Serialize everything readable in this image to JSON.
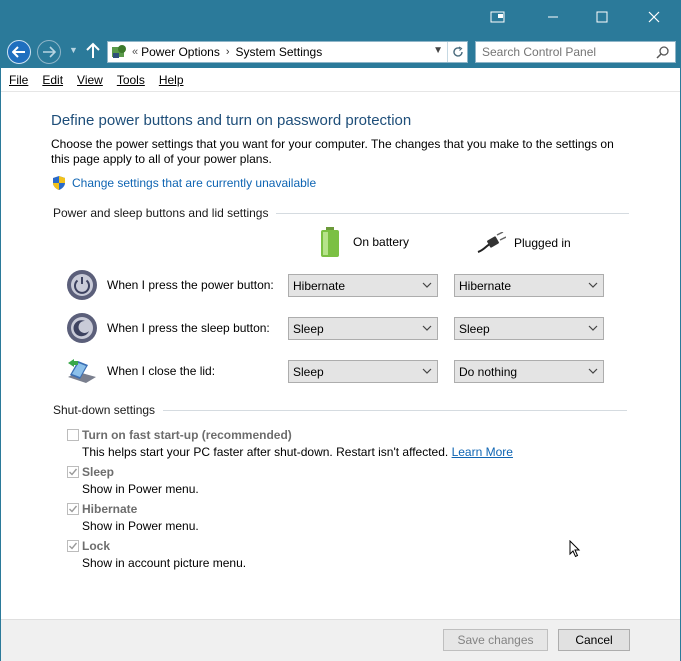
{
  "titlebar": {
    "buttons": [
      "pin",
      "minimize",
      "maximize",
      "close"
    ]
  },
  "address": {
    "overflow": "«",
    "crumbs": [
      "Power Options",
      "System Settings"
    ],
    "search_placeholder": "Search Control Panel"
  },
  "menu": [
    "File",
    "Edit",
    "View",
    "Tools",
    "Help"
  ],
  "page": {
    "title": "Define power buttons and turn on password protection",
    "description": "Choose the power settings that you want for your computer. The changes that you make to the settings on this page apply to all of your power plans.",
    "change_link": "Change settings that are currently unavailable"
  },
  "power_section": {
    "header": "Power and sleep buttons and lid settings",
    "col_battery": "On battery",
    "col_plugged": "Plugged in",
    "rows": [
      {
        "label": "When I press the power button:",
        "battery": "Hibernate",
        "plugged": "Hibernate"
      },
      {
        "label": "When I press the sleep button:",
        "battery": "Sleep",
        "plugged": "Sleep"
      },
      {
        "label": "When I close the lid:",
        "battery": "Sleep",
        "plugged": "Do nothing"
      }
    ]
  },
  "shutdown_section": {
    "header": "Shut-down settings",
    "items": [
      {
        "label": "Turn on fast start-up (recommended)",
        "checked": false,
        "desc": "This helps start your PC faster after shut-down. Restart isn't affected.",
        "link": "Learn More"
      },
      {
        "label": "Sleep",
        "checked": true,
        "desc": "Show in Power menu."
      },
      {
        "label": "Hibernate",
        "checked": true,
        "desc": "Show in Power menu."
      },
      {
        "label": "Lock",
        "checked": true,
        "desc": "Show in account picture menu."
      }
    ]
  },
  "footer": {
    "save_label": "Save changes",
    "cancel_label": "Cancel"
  },
  "colors": {
    "titlebar": "#2b7a9a",
    "title_text": "#1e4e79",
    "link": "#0f65b3"
  }
}
